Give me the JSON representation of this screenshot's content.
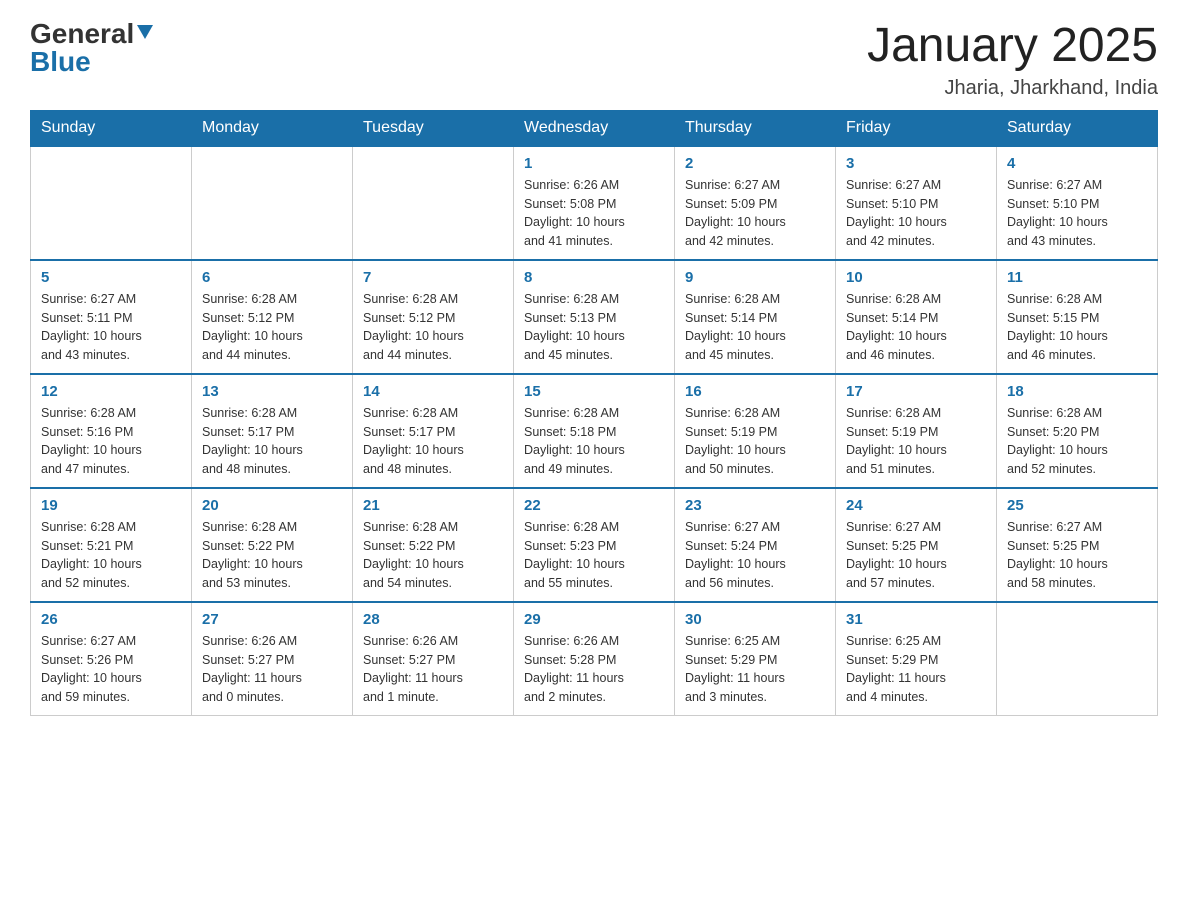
{
  "header": {
    "logo_general": "General",
    "logo_blue": "Blue",
    "month_title": "January 2025",
    "location": "Jharia, Jharkhand, India"
  },
  "days_of_week": [
    "Sunday",
    "Monday",
    "Tuesday",
    "Wednesday",
    "Thursday",
    "Friday",
    "Saturday"
  ],
  "weeks": [
    [
      {
        "day": "",
        "info": ""
      },
      {
        "day": "",
        "info": ""
      },
      {
        "day": "",
        "info": ""
      },
      {
        "day": "1",
        "info": "Sunrise: 6:26 AM\nSunset: 5:08 PM\nDaylight: 10 hours\nand 41 minutes."
      },
      {
        "day": "2",
        "info": "Sunrise: 6:27 AM\nSunset: 5:09 PM\nDaylight: 10 hours\nand 42 minutes."
      },
      {
        "day": "3",
        "info": "Sunrise: 6:27 AM\nSunset: 5:10 PM\nDaylight: 10 hours\nand 42 minutes."
      },
      {
        "day": "4",
        "info": "Sunrise: 6:27 AM\nSunset: 5:10 PM\nDaylight: 10 hours\nand 43 minutes."
      }
    ],
    [
      {
        "day": "5",
        "info": "Sunrise: 6:27 AM\nSunset: 5:11 PM\nDaylight: 10 hours\nand 43 minutes."
      },
      {
        "day": "6",
        "info": "Sunrise: 6:28 AM\nSunset: 5:12 PM\nDaylight: 10 hours\nand 44 minutes."
      },
      {
        "day": "7",
        "info": "Sunrise: 6:28 AM\nSunset: 5:12 PM\nDaylight: 10 hours\nand 44 minutes."
      },
      {
        "day": "8",
        "info": "Sunrise: 6:28 AM\nSunset: 5:13 PM\nDaylight: 10 hours\nand 45 minutes."
      },
      {
        "day": "9",
        "info": "Sunrise: 6:28 AM\nSunset: 5:14 PM\nDaylight: 10 hours\nand 45 minutes."
      },
      {
        "day": "10",
        "info": "Sunrise: 6:28 AM\nSunset: 5:14 PM\nDaylight: 10 hours\nand 46 minutes."
      },
      {
        "day": "11",
        "info": "Sunrise: 6:28 AM\nSunset: 5:15 PM\nDaylight: 10 hours\nand 46 minutes."
      }
    ],
    [
      {
        "day": "12",
        "info": "Sunrise: 6:28 AM\nSunset: 5:16 PM\nDaylight: 10 hours\nand 47 minutes."
      },
      {
        "day": "13",
        "info": "Sunrise: 6:28 AM\nSunset: 5:17 PM\nDaylight: 10 hours\nand 48 minutes."
      },
      {
        "day": "14",
        "info": "Sunrise: 6:28 AM\nSunset: 5:17 PM\nDaylight: 10 hours\nand 48 minutes."
      },
      {
        "day": "15",
        "info": "Sunrise: 6:28 AM\nSunset: 5:18 PM\nDaylight: 10 hours\nand 49 minutes."
      },
      {
        "day": "16",
        "info": "Sunrise: 6:28 AM\nSunset: 5:19 PM\nDaylight: 10 hours\nand 50 minutes."
      },
      {
        "day": "17",
        "info": "Sunrise: 6:28 AM\nSunset: 5:19 PM\nDaylight: 10 hours\nand 51 minutes."
      },
      {
        "day": "18",
        "info": "Sunrise: 6:28 AM\nSunset: 5:20 PM\nDaylight: 10 hours\nand 52 minutes."
      }
    ],
    [
      {
        "day": "19",
        "info": "Sunrise: 6:28 AM\nSunset: 5:21 PM\nDaylight: 10 hours\nand 52 minutes."
      },
      {
        "day": "20",
        "info": "Sunrise: 6:28 AM\nSunset: 5:22 PM\nDaylight: 10 hours\nand 53 minutes."
      },
      {
        "day": "21",
        "info": "Sunrise: 6:28 AM\nSunset: 5:22 PM\nDaylight: 10 hours\nand 54 minutes."
      },
      {
        "day": "22",
        "info": "Sunrise: 6:28 AM\nSunset: 5:23 PM\nDaylight: 10 hours\nand 55 minutes."
      },
      {
        "day": "23",
        "info": "Sunrise: 6:27 AM\nSunset: 5:24 PM\nDaylight: 10 hours\nand 56 minutes."
      },
      {
        "day": "24",
        "info": "Sunrise: 6:27 AM\nSunset: 5:25 PM\nDaylight: 10 hours\nand 57 minutes."
      },
      {
        "day": "25",
        "info": "Sunrise: 6:27 AM\nSunset: 5:25 PM\nDaylight: 10 hours\nand 58 minutes."
      }
    ],
    [
      {
        "day": "26",
        "info": "Sunrise: 6:27 AM\nSunset: 5:26 PM\nDaylight: 10 hours\nand 59 minutes."
      },
      {
        "day": "27",
        "info": "Sunrise: 6:26 AM\nSunset: 5:27 PM\nDaylight: 11 hours\nand 0 minutes."
      },
      {
        "day": "28",
        "info": "Sunrise: 6:26 AM\nSunset: 5:27 PM\nDaylight: 11 hours\nand 1 minute."
      },
      {
        "day": "29",
        "info": "Sunrise: 6:26 AM\nSunset: 5:28 PM\nDaylight: 11 hours\nand 2 minutes."
      },
      {
        "day": "30",
        "info": "Sunrise: 6:25 AM\nSunset: 5:29 PM\nDaylight: 11 hours\nand 3 minutes."
      },
      {
        "day": "31",
        "info": "Sunrise: 6:25 AM\nSunset: 5:29 PM\nDaylight: 11 hours\nand 4 minutes."
      },
      {
        "day": "",
        "info": ""
      }
    ]
  ]
}
